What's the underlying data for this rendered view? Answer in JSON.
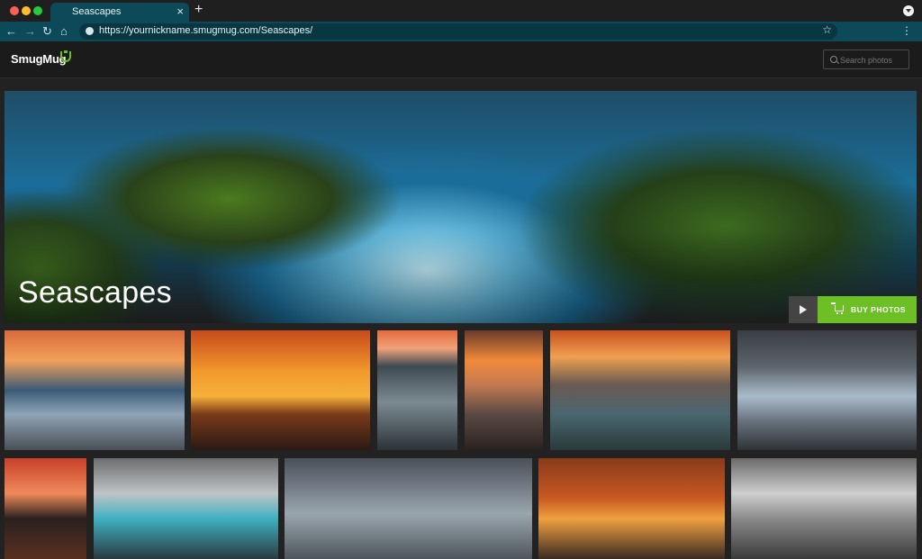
{
  "browser": {
    "tab_title": "Seascapes",
    "tab_close": "×",
    "new_tab": "+",
    "nav": {
      "back": "←",
      "forward": "→",
      "reload": "↻",
      "home": "⌂"
    },
    "url": "https://yournickname.smugmug.com/Seascapes/",
    "bookmark_icon": "☆",
    "menu_icon": "⋮"
  },
  "site": {
    "logo_text": "SmugMug",
    "search": {
      "placeholder": "Search photos",
      "value": ""
    }
  },
  "hero": {
    "title": "Seascapes",
    "buy_label": "BUY PHOTOS"
  },
  "gallery": {
    "thumbnails": [
      "sunset-beach-rocks",
      "golden-gate-sunset",
      "rock-channel",
      "sunset-shore-rock",
      "sea-stacks-sunset",
      "ice-beach",
      "kirkjufell-mountain",
      "waterfall-terraces",
      "waterfall-cliffs",
      "rock-arch-sunlight",
      "golden-gate-bw"
    ]
  },
  "colors": {
    "accent_green": "#6cc024",
    "browser_teal": "#0c4a5a",
    "header_bg": "#1b1b1b"
  }
}
